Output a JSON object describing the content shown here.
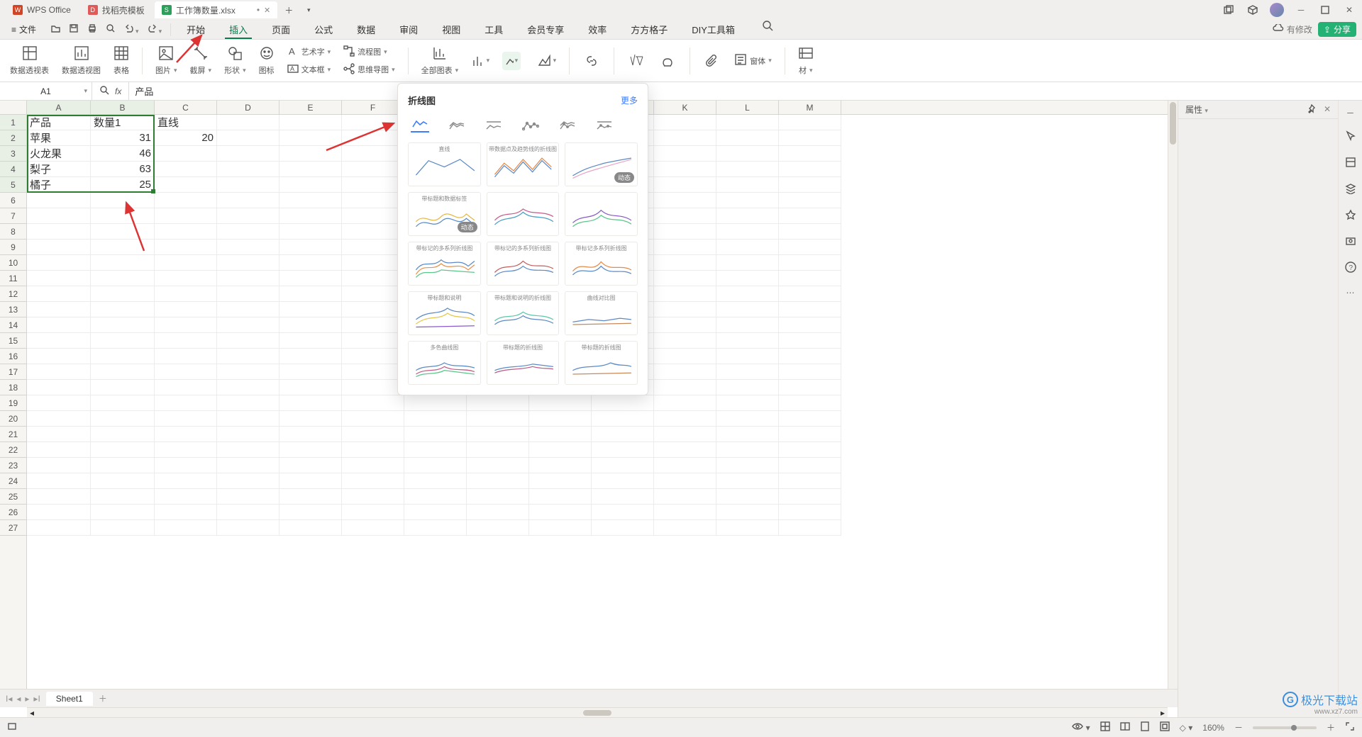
{
  "app": {
    "name": "WPS Office"
  },
  "tabs": [
    {
      "icon_bg": "#d14424",
      "icon_text": "",
      "label": "WPS Office",
      "active": false
    },
    {
      "icon_bg": "#e05a5a",
      "icon_text": "",
      "label": "找稻壳模板",
      "active": false
    },
    {
      "icon_bg": "#2e9e5b",
      "icon_text": "S",
      "label": "工作簿数量.xlsx",
      "active": true,
      "dirty": "•"
    }
  ],
  "file_menu": "文件",
  "menu": [
    "开始",
    "插入",
    "页面",
    "公式",
    "数据",
    "审阅",
    "视图",
    "工具",
    "会员专享",
    "效率",
    "方方格子",
    "DIY工具箱"
  ],
  "menu_active_index": 1,
  "cloud_status": "有修改",
  "share": "分享",
  "ribbon": {
    "pivot_table": "数据透视表",
    "pivot_chart": "数据透视图",
    "table": "表格",
    "picture": "图片",
    "screenshot": "截屏",
    "shapes": "形状",
    "icons": "图标",
    "artText": "艺术字",
    "textbox": "文本框",
    "flow": "流程图",
    "mindmap": "思维导图",
    "allCharts": "全部图表",
    "form": "窗体",
    "material": "材"
  },
  "name_box": "A1",
  "formula_value": "产品",
  "columns": [
    "A",
    "B",
    "C",
    "D",
    "E",
    "F",
    "G",
    "H",
    "I",
    "J",
    "K",
    "L",
    "M"
  ],
  "rows_count": 27,
  "selected_rows": [
    1,
    2,
    3,
    4,
    5
  ],
  "cells": {
    "A1": "产品",
    "B1": "数量1",
    "C1": "直线",
    "A2": "苹果",
    "B2": "31",
    "C2": "20",
    "A3": "火龙果",
    "B3": "46",
    "A4": "梨子",
    "B4": "63",
    "A5": "橘子",
    "B5": "25"
  },
  "chart_popup": {
    "title": "折线图",
    "more": "更多",
    "types": [
      "line-basic",
      "line-marker",
      "line-step",
      "line-marker2",
      "line-trend",
      "line-100"
    ],
    "dyn_badge": "动态",
    "template_titles": [
      "直线",
      "带数据点及趋势线的折线图",
      "",
      "带标题和数据标签",
      "",
      "",
      "带标记的多系列折线图",
      "带标记的多系列折线图",
      "带标记多系列折线图",
      "带标题和说明",
      "带标题和说明的折线图",
      "曲线对比图",
      "多色曲线图",
      "带标题的折线图",
      "带标题的折线图"
    ]
  },
  "right_panel_title": "属性",
  "sheet_tabs": [
    "Sheet1"
  ],
  "status": {
    "zoom": "160%"
  },
  "watermark": "极光下载站",
  "watermark_url": "www.xz7.com"
}
